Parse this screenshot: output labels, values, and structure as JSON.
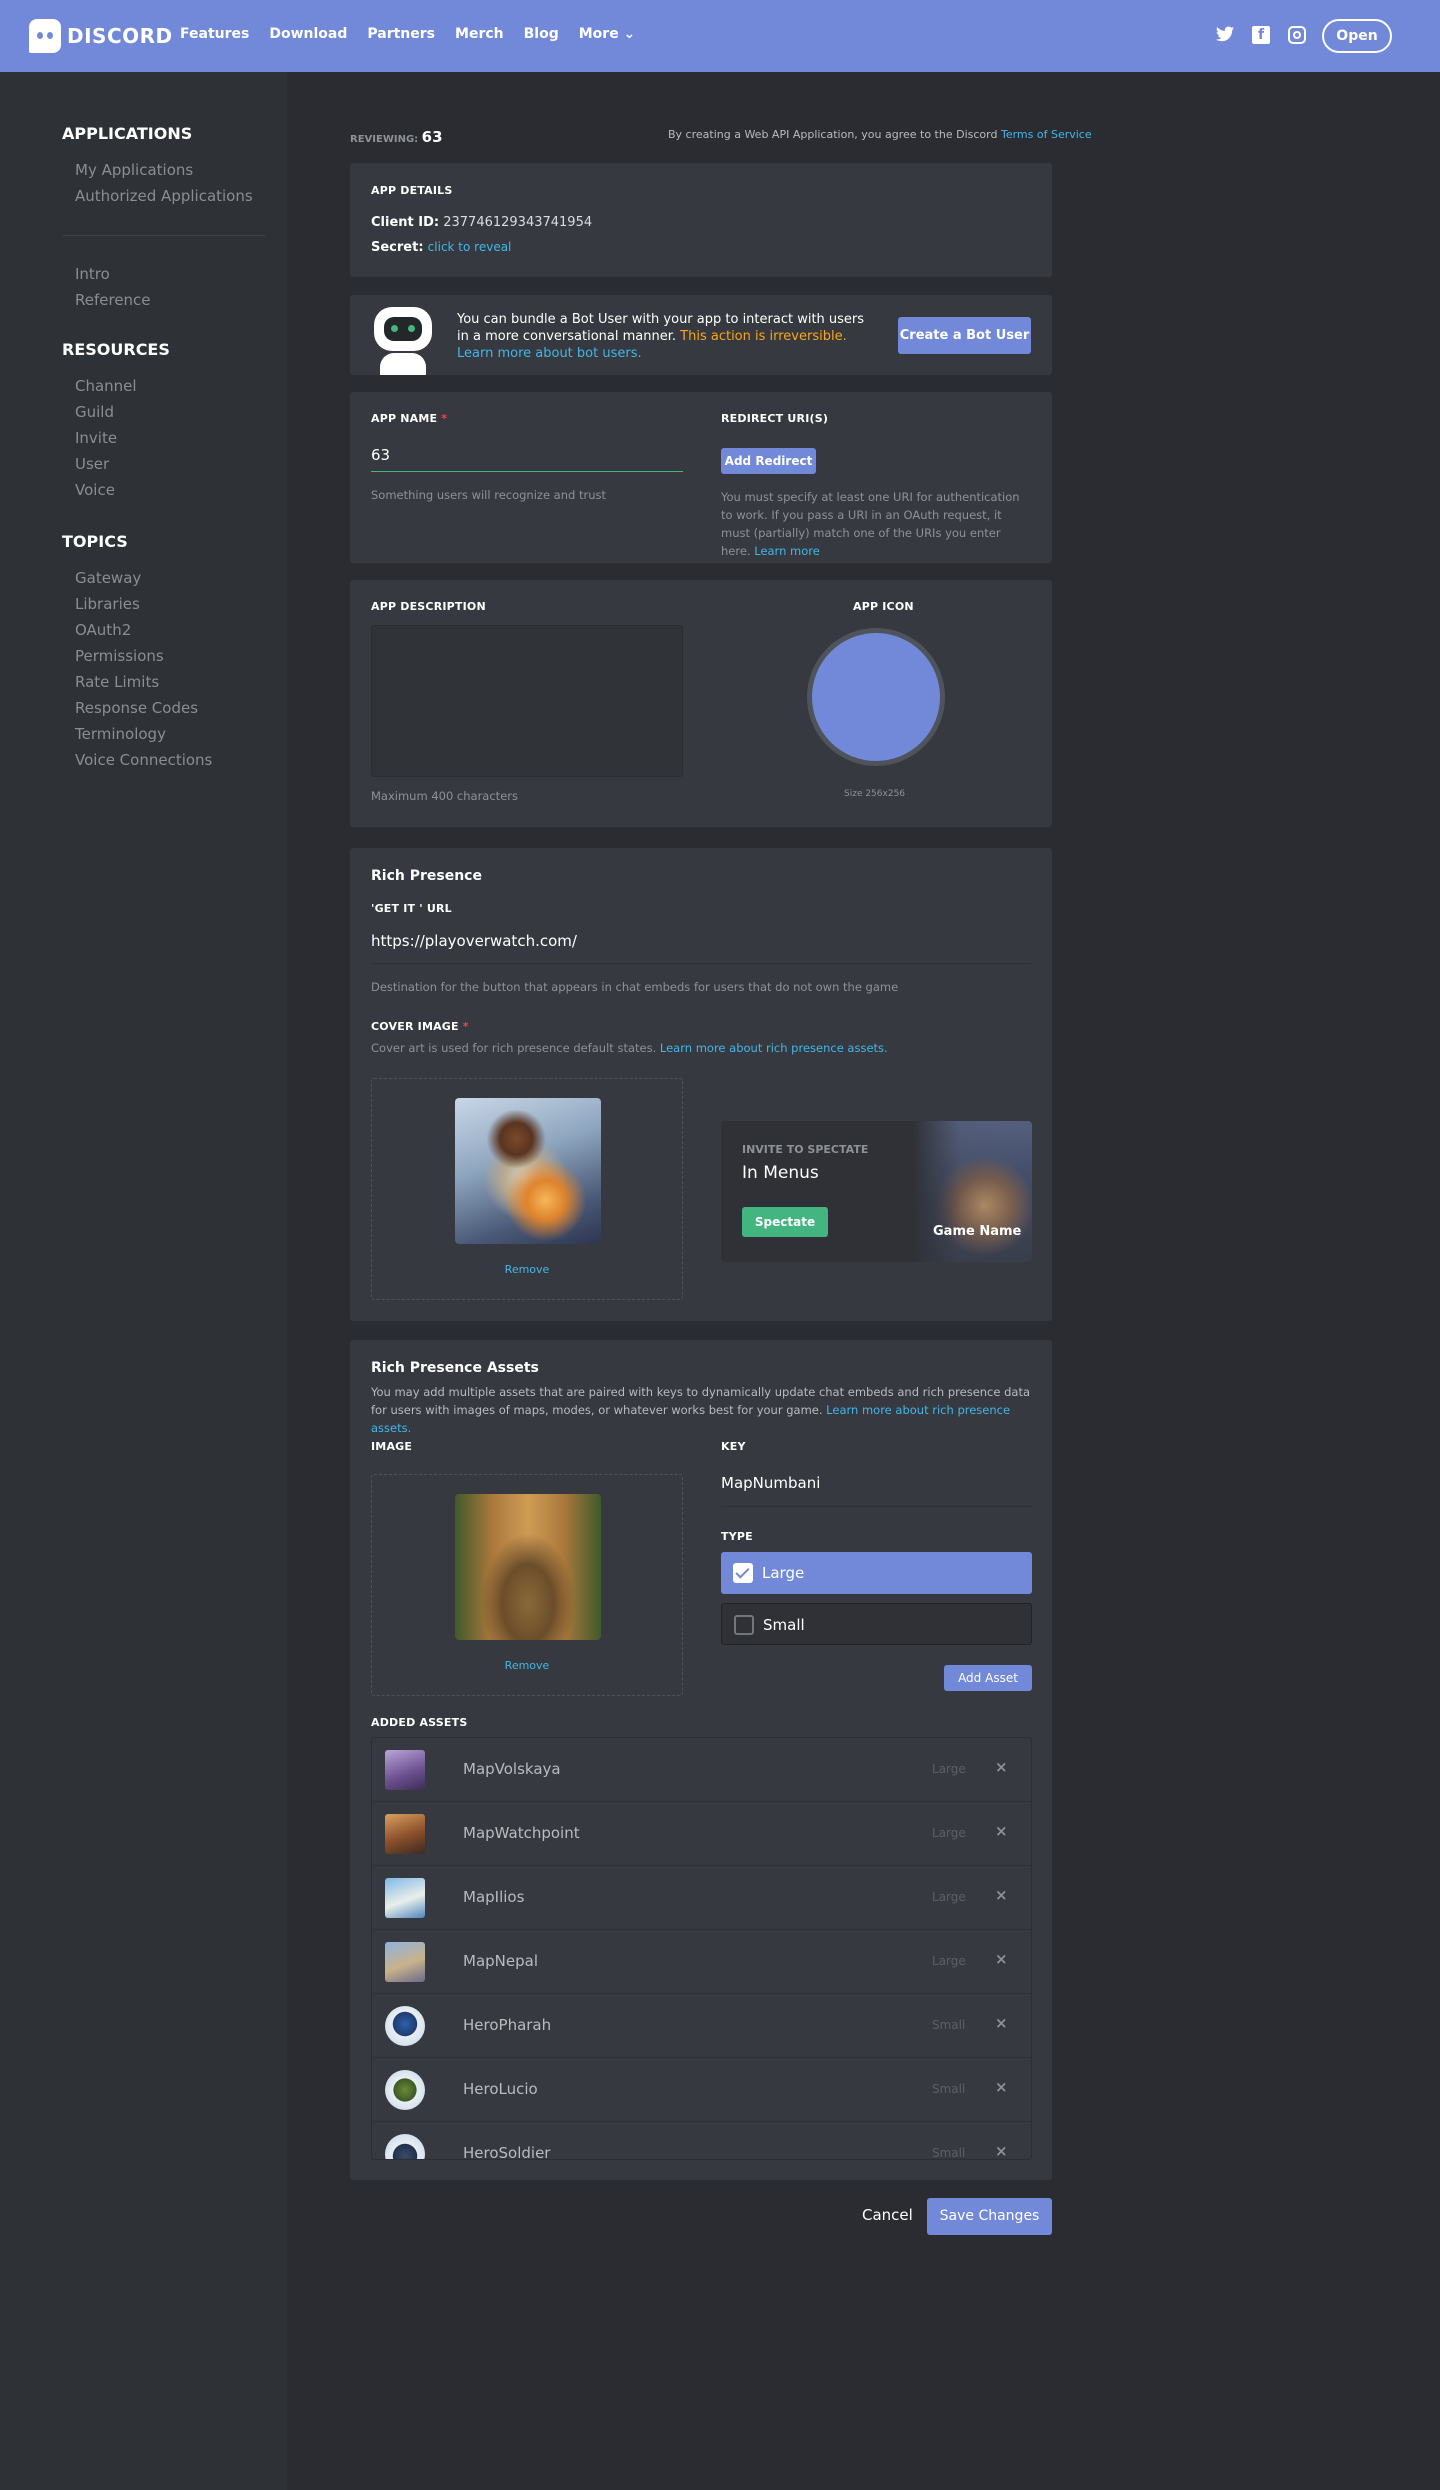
{
  "nav": {
    "logo_text": "DISCORD",
    "links": [
      "Features",
      "Download",
      "Partners",
      "Merch",
      "Blog",
      "More ⌄"
    ],
    "open_label": "Open"
  },
  "sidebar": {
    "applications_heading": "APPLICATIONS",
    "app_items": [
      "My Applications",
      "Authorized Applications"
    ],
    "doc_items": [
      "Intro",
      "Reference"
    ],
    "resources_heading": "RESOURCES",
    "resources": [
      "Channel",
      "Guild",
      "Invite",
      "User",
      "Voice"
    ],
    "topics_heading": "TOPICS",
    "topics": [
      "Gateway",
      "Libraries",
      "OAuth2",
      "Permissions",
      "Rate Limits",
      "Response Codes",
      "Terminology",
      "Voice Connections"
    ]
  },
  "header": {
    "reviewing_label": "REVIEWING:",
    "reviewing_value": "63",
    "tos_text": "By creating a Web API Application, you agree to the Discord",
    "tos_link": "Terms of Service"
  },
  "app_details": {
    "heading": "APP DETAILS",
    "client_id_label": "Client ID:",
    "client_id": "237746129343741954",
    "secret_label": "Secret:",
    "secret_link": "click to reveal"
  },
  "bot": {
    "text": "You can bundle a Bot User with your app to interact with users in a more conversational manner.",
    "warning": "This action is irreversible.",
    "learn_link": "Learn more about bot users.",
    "button": "Create a Bot User"
  },
  "app_name": {
    "label": "APP NAME",
    "required": "*",
    "value": "63",
    "hint": "Something users will recognize and trust"
  },
  "redirect": {
    "label": "REDIRECT URI(S)",
    "button": "Add Redirect",
    "note": "You must specify at least one URI for authentication to work. If you pass a URI in an OAuth request, it must (partially) match one of the URIs you enter here.",
    "learn_link": "Learn more"
  },
  "description": {
    "label": "APP DESCRIPTION",
    "hint": "Maximum 400 characters"
  },
  "icon": {
    "label": "APP ICON",
    "size_hint": "Size 256x256",
    "color": "#7289da"
  },
  "rich_presence": {
    "title": "Rich Presence",
    "get_it_label": "'GET IT ' URL",
    "url": "https://playoverwatch.com/",
    "url_hint": "Destination for the button that appears in chat embeds for users that do not own the game",
    "cover_label": "COVER IMAGE",
    "cover_required": "*",
    "cover_hint": "Cover art is used for rich presence default states.",
    "cover_link": "Learn more about rich presence assets.",
    "remove": "Remove",
    "spectate_heading": "INVITE TO SPECTATE",
    "spectate_status": "In Menus",
    "spectate_button": "Spectate",
    "game_name": "Game Name"
  },
  "assets": {
    "title": "Rich Presence Assets",
    "subtitle": "You may add multiple assets that are paired with keys to dynamically update chat embeds and rich presence data for users with images of maps, modes, or whatever works best for your game.",
    "subtitle_link": "Learn more about rich presence assets.",
    "image_label": "IMAGE",
    "remove": "Remove",
    "key_label": "KEY",
    "key_value": "MapNumbani",
    "type_label": "TYPE",
    "type_large": "Large",
    "type_small": "Small",
    "add_button": "Add Asset",
    "added_label": "ADDED ASSETS",
    "list": [
      {
        "name": "MapVolskaya",
        "type": "Large",
        "remove": "×"
      },
      {
        "name": "MapWatchpoint",
        "type": "Large",
        "remove": "×"
      },
      {
        "name": "MapIlios",
        "type": "Large",
        "remove": "×"
      },
      {
        "name": "MapNepal",
        "type": "Large",
        "remove": "×"
      },
      {
        "name": "HeroPharah",
        "type": "Small",
        "remove": "×"
      },
      {
        "name": "HeroLucio",
        "type": "Small",
        "remove": "×"
      },
      {
        "name": "HeroSoldier",
        "type": "Small",
        "remove": "×"
      }
    ]
  },
  "actions": {
    "cancel": "Cancel",
    "save": "Save Changes"
  },
  "colors": {
    "brand": "#7289da",
    "success": "#43b581",
    "warning": "#faa61a",
    "link": "#43b6e8"
  }
}
